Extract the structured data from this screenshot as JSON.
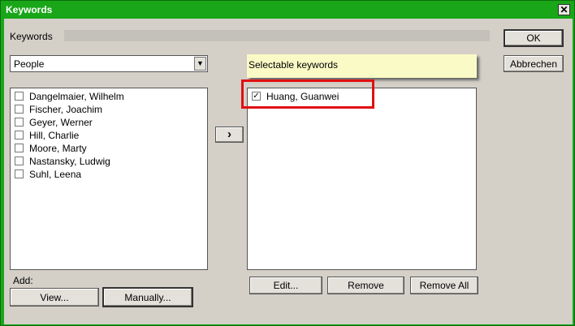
{
  "window": {
    "title": "Keywords",
    "close_glyph": "✕"
  },
  "section": {
    "label": "Keywords"
  },
  "buttons": {
    "ok": "OK",
    "cancel": "Abbrechen",
    "move_right": "›",
    "edit": "Edit...",
    "remove": "Remove",
    "remove_all": "Remove All",
    "view": "View...",
    "manually": "Manually..."
  },
  "category_select": {
    "value": "People",
    "arrow_icon": "chevron-down-icon"
  },
  "available_keywords": [
    {
      "label": "Dangelmaier, Wilhelm",
      "checked": false
    },
    {
      "label": "Fischer, Joachim",
      "checked": false
    },
    {
      "label": "Geyer, Werner",
      "checked": false
    },
    {
      "label": "Hill, Charlie",
      "checked": false
    },
    {
      "label": "Moore, Marty",
      "checked": false
    },
    {
      "label": "Nastansky, Ludwig",
      "checked": false
    },
    {
      "label": "Suhl, Leena",
      "checked": false
    }
  ],
  "selected_keywords": [
    {
      "label": "Huang, Guanwei",
      "checked": true
    }
  ],
  "tooltip": {
    "text": "Selectable keywords"
  },
  "add": {
    "label": "Add:"
  },
  "colors": {
    "title_bar": "#19a619",
    "dialog_bg": "#d4d0c8",
    "highlight": "#e01010",
    "tooltip_bg": "#fafac6"
  }
}
